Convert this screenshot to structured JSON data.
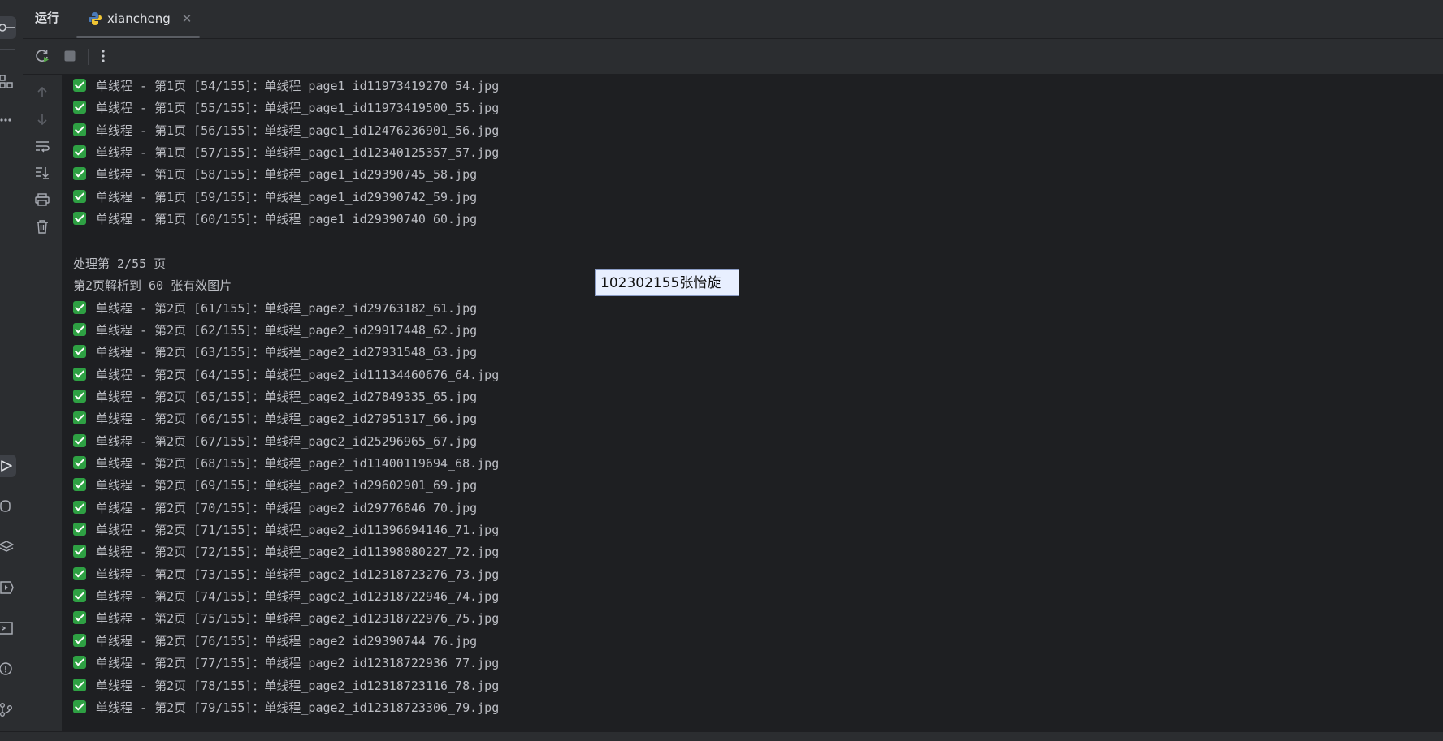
{
  "toolwindow": {
    "title": "运行"
  },
  "tab": {
    "label": "xiancheng",
    "close": "✕"
  },
  "console": {
    "lines": [
      {
        "check": true,
        "text": "单线程 - 第1页 [54/155]：单线程_page1_id11973419270_54.jpg"
      },
      {
        "check": true,
        "text": "单线程 - 第1页 [55/155]：单线程_page1_id11973419500_55.jpg"
      },
      {
        "check": true,
        "text": "单线程 - 第1页 [56/155]：单线程_page1_id12476236901_56.jpg"
      },
      {
        "check": true,
        "text": "单线程 - 第1页 [57/155]：单线程_page1_id12340125357_57.jpg"
      },
      {
        "check": true,
        "text": "单线程 - 第1页 [58/155]：单线程_page1_id29390745_58.jpg"
      },
      {
        "check": true,
        "text": "单线程 - 第1页 [59/155]：单线程_page1_id29390742_59.jpg"
      },
      {
        "check": true,
        "text": "单线程 - 第1页 [60/155]：单线程_page1_id29390740_60.jpg"
      },
      {
        "check": false,
        "text": ""
      },
      {
        "check": false,
        "text": "处理第 2/55 页"
      },
      {
        "check": false,
        "text": "第2页解析到 60 张有效图片"
      },
      {
        "check": true,
        "text": "单线程 - 第2页 [61/155]：单线程_page2_id29763182_61.jpg"
      },
      {
        "check": true,
        "text": "单线程 - 第2页 [62/155]：单线程_page2_id29917448_62.jpg"
      },
      {
        "check": true,
        "text": "单线程 - 第2页 [63/155]：单线程_page2_id27931548_63.jpg"
      },
      {
        "check": true,
        "text": "单线程 - 第2页 [64/155]：单线程_page2_id11134460676_64.jpg"
      },
      {
        "check": true,
        "text": "单线程 - 第2页 [65/155]：单线程_page2_id27849335_65.jpg"
      },
      {
        "check": true,
        "text": "单线程 - 第2页 [66/155]：单线程_page2_id27951317_66.jpg"
      },
      {
        "check": true,
        "text": "单线程 - 第2页 [67/155]：单线程_page2_id25296965_67.jpg"
      },
      {
        "check": true,
        "text": "单线程 - 第2页 [68/155]：单线程_page2_id11400119694_68.jpg"
      },
      {
        "check": true,
        "text": "单线程 - 第2页 [69/155]：单线程_page2_id29602901_69.jpg"
      },
      {
        "check": true,
        "text": "单线程 - 第2页 [70/155]：单线程_page2_id29776846_70.jpg"
      },
      {
        "check": true,
        "text": "单线程 - 第2页 [71/155]：单线程_page2_id11396694146_71.jpg"
      },
      {
        "check": true,
        "text": "单线程 - 第2页 [72/155]：单线程_page2_id11398080227_72.jpg"
      },
      {
        "check": true,
        "text": "单线程 - 第2页 [73/155]：单线程_page2_id12318723276_73.jpg"
      },
      {
        "check": true,
        "text": "单线程 - 第2页 [74/155]：单线程_page2_id12318722946_74.jpg"
      },
      {
        "check": true,
        "text": "单线程 - 第2页 [75/155]：单线程_page2_id12318722976_75.jpg"
      },
      {
        "check": true,
        "text": "单线程 - 第2页 [76/155]：单线程_page2_id29390744_76.jpg"
      },
      {
        "check": true,
        "text": "单线程 - 第2页 [77/155]：单线程_page2_id12318722936_77.jpg"
      },
      {
        "check": true,
        "text": "单线程 - 第2页 [78/155]：单线程_page2_id12318723116_78.jpg"
      },
      {
        "check": true,
        "text": "单线程 - 第2页 [79/155]：单线程_page2_id12318723306_79.jpg"
      }
    ]
  },
  "overlay": {
    "label": "102302155张怡旋"
  },
  "colors": {
    "check": "#2ea043",
    "text": "#bcbec4",
    "background": "#1e1f22",
    "panel": "#2b2d30"
  }
}
